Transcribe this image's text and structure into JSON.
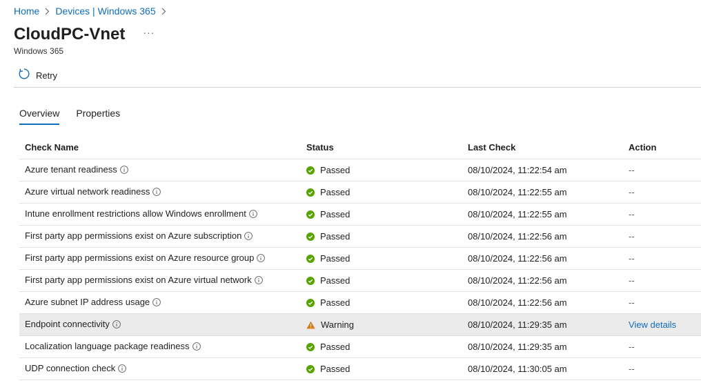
{
  "breadcrumb": {
    "items": [
      "Home",
      "Devices | Windows 365"
    ]
  },
  "header": {
    "title": "CloudPC-Vnet",
    "more": "···",
    "subtitle": "Windows 365"
  },
  "toolbar": {
    "retry_label": "Retry"
  },
  "tabs": [
    {
      "label": "Overview",
      "active": true
    },
    {
      "label": "Properties",
      "active": false
    }
  ],
  "table": {
    "columns": [
      "Check Name",
      "Status",
      "Last Check",
      "Action"
    ],
    "rows": [
      {
        "name": "Azure tenant readiness",
        "status": "Passed",
        "last_check": "08/10/2024, 11:22:54 am",
        "action": "--"
      },
      {
        "name": "Azure virtual network readiness",
        "status": "Passed",
        "last_check": "08/10/2024, 11:22:55 am",
        "action": "--"
      },
      {
        "name": "Intune enrollment restrictions allow Windows enrollment",
        "status": "Passed",
        "last_check": "08/10/2024, 11:22:55 am",
        "action": "--"
      },
      {
        "name": "First party app permissions exist on Azure subscription",
        "status": "Passed",
        "last_check": "08/10/2024, 11:22:56 am",
        "action": "--"
      },
      {
        "name": "First party app permissions exist on Azure resource group",
        "status": "Passed",
        "last_check": "08/10/2024, 11:22:56 am",
        "action": "--"
      },
      {
        "name": "First party app permissions exist on Azure virtual network",
        "status": "Passed",
        "last_check": "08/10/2024, 11:22:56 am",
        "action": "--"
      },
      {
        "name": "Azure subnet IP address usage",
        "status": "Passed",
        "last_check": "08/10/2024, 11:22:56 am",
        "action": "--"
      },
      {
        "name": "Endpoint connectivity",
        "status": "Warning",
        "last_check": "08/10/2024, 11:29:35 am",
        "action": "View details"
      },
      {
        "name": "Localization language package readiness",
        "status": "Passed",
        "last_check": "08/10/2024, 11:29:35 am",
        "action": "--"
      },
      {
        "name": "UDP connection check",
        "status": "Passed",
        "last_check": "08/10/2024, 11:30:05 am",
        "action": "--"
      }
    ]
  },
  "colors": {
    "link": "#0f6cbd",
    "passed": "#57a300",
    "warning": "#da7b11",
    "highlight_row": "#ebebeb"
  },
  "icons": {
    "retry": "refresh-icon",
    "info": "info-icon",
    "passed": "check-circle-icon",
    "warning": "warning-triangle-icon"
  }
}
